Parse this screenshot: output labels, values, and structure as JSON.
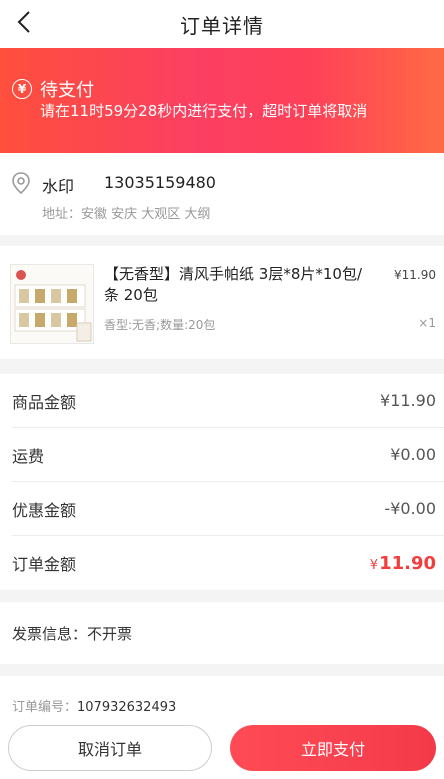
{
  "header": {
    "title": "订单详情",
    "back_icon": "chevron-left-icon"
  },
  "status": {
    "icon": "yen-circle-icon",
    "icon_glyph": "¥",
    "title": "待支付",
    "desc": "请在11时59分28秒内进行支付，超时订单将取消"
  },
  "address": {
    "icon": "location-pin-icon",
    "name": "水印",
    "phone": "13035159480",
    "detail": "地址：安徽 安庆 大观区 大纲"
  },
  "product": {
    "title": "【无香型】清风手帕纸 3层*8片*10包/条 20包",
    "spec": "香型:无香;数量:20包",
    "price": "¥11.90",
    "qty": "×1"
  },
  "amounts": {
    "goods_label": "商品金额",
    "goods_value": "¥11.90",
    "freight_label": "运费",
    "freight_value": "¥0.00",
    "discount_label": "优惠金额",
    "discount_value": "-¥0.00",
    "total_label": "订单金额",
    "total_currency": "¥",
    "total_value": "11.90"
  },
  "invoice": {
    "text": "发票信息：不开票"
  },
  "order": {
    "label": "订单编号：",
    "number": "107932632493"
  },
  "actions": {
    "cancel_label": "取消订单",
    "pay_label": "立即支付"
  },
  "colors": {
    "accent": "#f23d3d",
    "banner_start": "#ff4f3d",
    "banner_end": "#ff6a44"
  }
}
